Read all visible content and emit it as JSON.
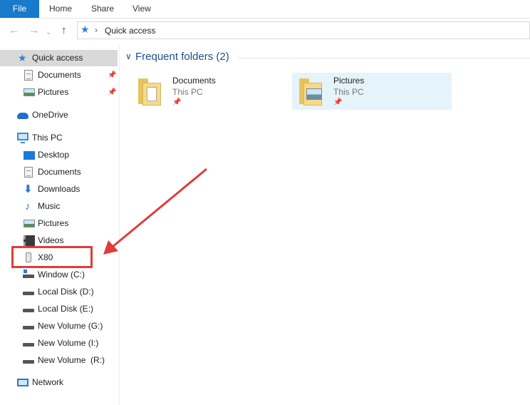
{
  "ribbon": {
    "tabs": [
      {
        "label": "File"
      },
      {
        "label": "Home"
      },
      {
        "label": "Share"
      },
      {
        "label": "View"
      }
    ]
  },
  "address": {
    "breadcrumb": "Quick access",
    "icon": "star-icon"
  },
  "sidebar": {
    "items": [
      {
        "label": "Quick access",
        "icon": "quick-access-star-icon",
        "pinned": false,
        "selected": true
      },
      {
        "label": "Documents",
        "icon": "documents-icon",
        "pinned": true
      },
      {
        "label": "Pictures",
        "icon": "pictures-icon",
        "pinned": true
      },
      {
        "label": "OneDrive",
        "icon": "onedrive-icon"
      },
      {
        "label": "This PC",
        "icon": "computer-icon"
      },
      {
        "label": "Desktop",
        "icon": "desktop-icon"
      },
      {
        "label": "Documents",
        "icon": "documents-icon"
      },
      {
        "label": "Downloads",
        "icon": "download-arrow-icon"
      },
      {
        "label": "Music",
        "icon": "music-note-icon"
      },
      {
        "label": "Pictures",
        "icon": "pictures-icon"
      },
      {
        "label": "Videos",
        "icon": "film-strip-icon"
      },
      {
        "label": "X80",
        "icon": "portable-device-icon"
      },
      {
        "label": "Window (C:)",
        "icon": "windows-drive-icon"
      },
      {
        "label": "Local Disk (D:)",
        "icon": "drive-icon"
      },
      {
        "label": "Local Disk (E:)",
        "icon": "drive-icon"
      },
      {
        "label": "New Volume (G:)",
        "icon": "drive-icon"
      },
      {
        "label": "New Volume (I:)",
        "icon": "drive-icon"
      },
      {
        "label": "New Volume  (R:)",
        "icon": "drive-icon"
      },
      {
        "label": "Network",
        "icon": "network-icon"
      }
    ]
  },
  "content": {
    "group_title": "Frequent folders (2)",
    "folders": [
      {
        "name": "Documents",
        "location": "This PC",
        "pinned": true,
        "selected": false
      },
      {
        "name": "Pictures",
        "location": "This PC",
        "pinned": true,
        "selected": true
      }
    ]
  },
  "annotation": {
    "color": "#e23b3b",
    "highlighted_item": "X80"
  },
  "colors": {
    "file_tab": "#1979ca",
    "group_header": "#1e4e8c",
    "selected_tile": "#e5f3fb",
    "selected_nav": "#d9d9d9"
  }
}
